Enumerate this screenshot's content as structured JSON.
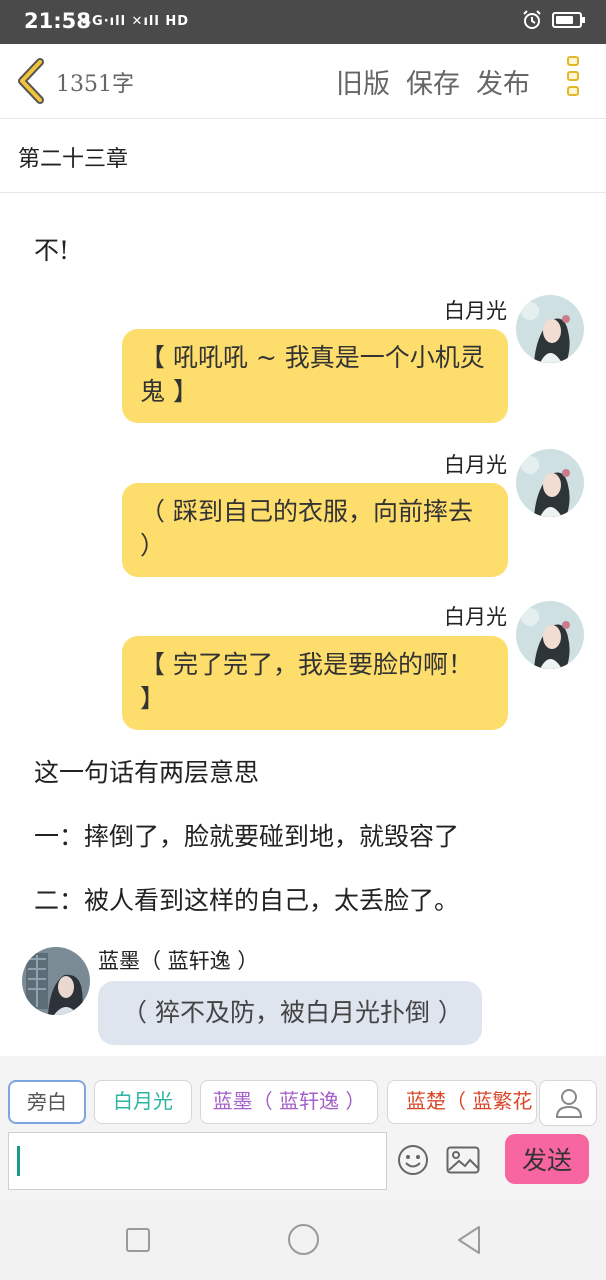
{
  "status_bar": {
    "time": "21:58",
    "network": "4G·ıll ✕ıll HD",
    "alarm_icon": "alarm-clock-icon",
    "battery_level": 0.75
  },
  "header": {
    "back_icon": "chevron-left-icon",
    "word_count": "1351字",
    "old_version_label": "旧版",
    "save_label": "保存",
    "publish_label": "发布",
    "more_icon": "more-vertical-icon",
    "accent_color": "#e2b82a"
  },
  "chapter": {
    "title": "第二十三章"
  },
  "story": {
    "line_no": "不!",
    "messages_right": [
      {
        "speaker": "白月光",
        "text": "【 吼吼吼 ~ 我真是一个小机灵鬼 】"
      },
      {
        "speaker": "白月光",
        "text": "（ 踩到自己的衣服，向前摔去 ）"
      },
      {
        "speaker": "白月光",
        "text": "【 完了完了，我是要脸的啊！ 】"
      }
    ],
    "narration_1": "这一句话有两层意思",
    "narration_2": "一：摔倒了，脸就要碰到地，就毁容了",
    "narration_3": "二：被人看到这样的自己，太丢脸了。",
    "message_left": {
      "speaker": "蓝墨（ 蓝轩逸 ）",
      "text": "（ 猝不及防，被白月光扑倒 ）"
    },
    "bubble_color_right": "#fddd6c",
    "bubble_color_left": "#dfe5ee"
  },
  "roles": {
    "items": [
      {
        "label": "旁白",
        "color": "#555555"
      },
      {
        "label": "白月光",
        "color": "#2bb5a0"
      },
      {
        "label": "蓝墨（ 蓝轩逸 ）",
        "color": "#a45fc9"
      },
      {
        "label": "蓝楚（ 蓝繁花 ）",
        "color": "#d9472b"
      }
    ],
    "add_role_icon": "user-icon"
  },
  "composer": {
    "input_value": "",
    "emoji_icon": "emoji-icon",
    "image_icon": "image-icon",
    "send_label": "发送",
    "send_color": "#f766a0"
  },
  "system_nav": {
    "recent_icon": "square-icon",
    "home_icon": "circle-icon",
    "back_icon": "triangle-back-icon"
  }
}
